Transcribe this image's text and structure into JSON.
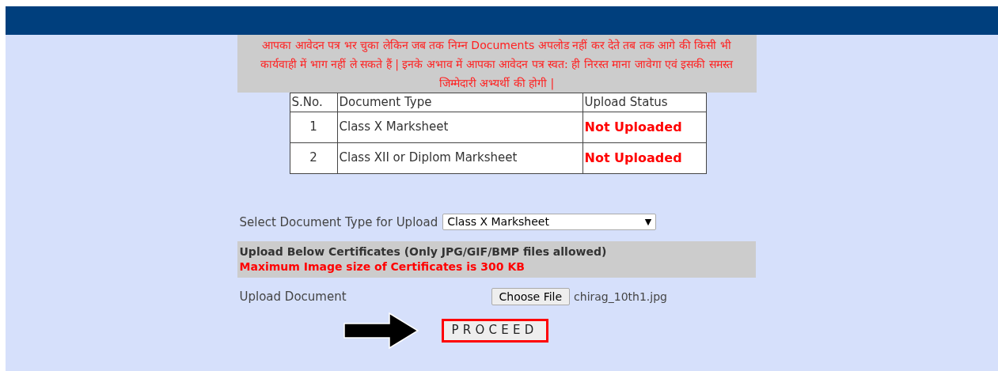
{
  "notice": "आपका आवेदन पत्र भर चुका लेकिन जब तक निम्न Documents अपलोड नहीं कर देते तब तक आगे की किसी भी कार्यवाही में भाग नहीं ले सकते हैं | इनके अभाव में आपका आवेदन पत्र स्वत: ही निरस्त माना जावेगा एवं इसकी समस्त जिम्मेदारी अभ्यर्थी की होगी |",
  "table": {
    "columns": [
      "S.No.",
      "Document Type",
      "Upload Status"
    ],
    "rows": [
      {
        "sno": "1",
        "type": "Class X Marksheet",
        "status": "Not Uploaded"
      },
      {
        "sno": "2",
        "type": "Class XII or Diplom Marksheet",
        "status": "Not Uploaded"
      }
    ]
  },
  "select": {
    "label": "Select Document Type for Upload",
    "value": "Class X Marksheet",
    "caret": "▼"
  },
  "info": {
    "title": "Upload Below Certificates (Only JPG/GIF/BMP files allowed)",
    "warning": "Maximum Image size of Certificates is 300 KB"
  },
  "upload": {
    "label": "Upload Document",
    "button": "Choose File",
    "file": "chirag_10th1.jpg"
  },
  "proceed": {
    "label": "PROCEED",
    "highlighted": true
  }
}
